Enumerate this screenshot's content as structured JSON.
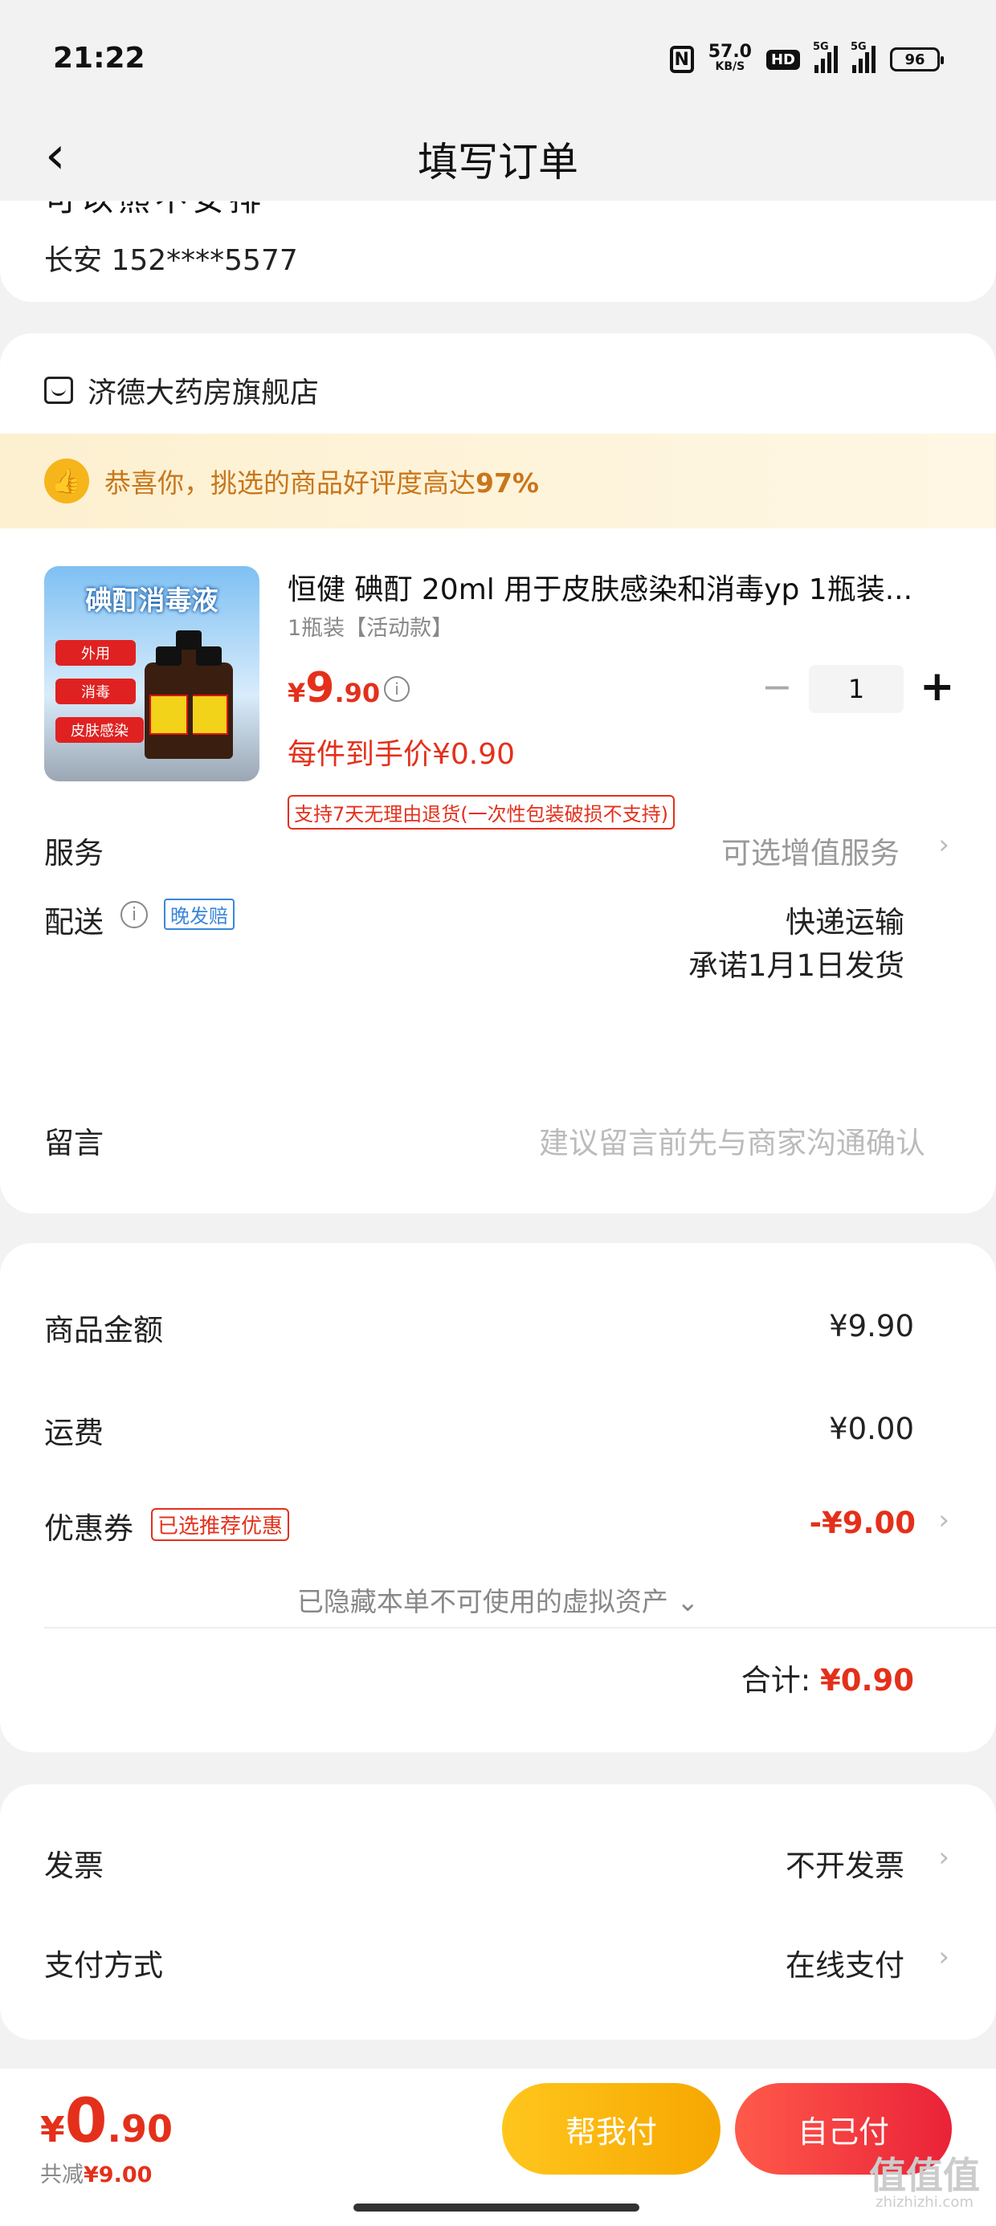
{
  "status_bar": {
    "time": "21:22",
    "speed_value": "57.0",
    "speed_unit": "KB/S",
    "hd": "HD",
    "signal_label_1": "5G",
    "signal_label_2": "5G",
    "battery": "96"
  },
  "header": {
    "title": "填写订单",
    "back_icon": "chevron-left-icon"
  },
  "address": {
    "cut_line": "可以熊不安排",
    "name_phone": "长安  152****5577"
  },
  "shop": {
    "name": "济德大药房旗舰店",
    "praise_prefix": "恭喜你，挑选的商品好评度高达",
    "praise_value": "97%",
    "product": {
      "image_banner": "碘酊消毒液",
      "image_tags": [
        "外用",
        "消毒",
        "皮肤感染"
      ],
      "title": "恒健 碘酊 20ml 用于皮肤感染和消毒yp 1瓶装...",
      "sku": "1瓶装【活动款】",
      "price_currency": "¥",
      "price_int": "9",
      "price_dec": ".90",
      "quantity": "1",
      "hand_price": "每件到手价¥0.90",
      "return_policy": "支持7天无理由退货(一次性包装破损不支持)"
    },
    "service_label": "服务",
    "service_value": "可选增值服务",
    "delivery_label": "配送",
    "delivery_tag": "晚发赔",
    "delivery_method": "快递运输",
    "delivery_promise": "承诺1月1日发货",
    "message_label": "留言",
    "message_placeholder": "建议留言前先与商家沟通确认"
  },
  "cost": {
    "goods_label": "商品金额",
    "goods_value": "¥9.90",
    "shipping_label": "运费",
    "shipping_value": "¥0.00",
    "coupon_label": "优惠券",
    "coupon_tag": "已选推荐优惠",
    "coupon_value": "-¥9.00",
    "hidden_note": "已隐藏本单不可使用的虚拟资产 ⌄",
    "total_label": "合计:",
    "total_value": "¥0.90"
  },
  "invoice": {
    "invoice_label": "发票",
    "invoice_value": "不开发票",
    "payment_label": "支付方式",
    "payment_value": "在线支付"
  },
  "bottom": {
    "currency": "¥",
    "int": "0",
    "dec": ".90",
    "saved_prefix": "共减",
    "saved_value": "¥9.00",
    "help_pay": "帮我付",
    "self_pay": "自己付",
    "watermark": "值值值",
    "watermark_small": "zhizhizhi.com"
  },
  "colors": {
    "accent_red": "#e4301b",
    "button_yellow": "#ffc61d",
    "button_red": "#ea2238",
    "praise_text": "#c8761b",
    "tag_blue": "#3a86d8"
  }
}
